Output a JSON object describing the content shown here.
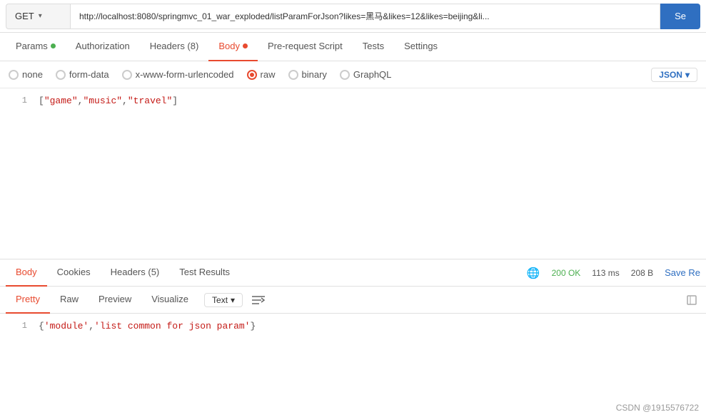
{
  "urlbar": {
    "method": "GET",
    "chevron": "▾",
    "url": "http://localhost:8080/springmvc_01_war_exploded/listParamForJson?likes=黑马&likes=12&likes=beijing&li...",
    "send_label": "Se"
  },
  "request_tabs": [
    {
      "id": "params",
      "label": "Params",
      "has_dot": true,
      "dot_type": "green",
      "active": false
    },
    {
      "id": "authorization",
      "label": "Authorization",
      "has_dot": false,
      "active": false
    },
    {
      "id": "headers",
      "label": "Headers (8)",
      "has_dot": false,
      "active": false
    },
    {
      "id": "body",
      "label": "Body",
      "has_dot": true,
      "dot_type": "orange",
      "active": true
    },
    {
      "id": "pre-request-script",
      "label": "Pre-request Script",
      "has_dot": false,
      "active": false
    },
    {
      "id": "tests",
      "label": "Tests",
      "has_dot": false,
      "active": false
    },
    {
      "id": "settings",
      "label": "Settings",
      "has_dot": false,
      "active": false
    }
  ],
  "body_options": [
    {
      "id": "none",
      "label": "none",
      "selected": false
    },
    {
      "id": "form-data",
      "label": "form-data",
      "selected": false
    },
    {
      "id": "x-www-form-urlencoded",
      "label": "x-www-form-urlencoded",
      "selected": false
    },
    {
      "id": "raw",
      "label": "raw",
      "selected": true
    },
    {
      "id": "binary",
      "label": "binary",
      "selected": false
    },
    {
      "id": "graphql",
      "label": "GraphQL",
      "selected": false
    }
  ],
  "json_badge": "JSON",
  "editor_code": "[\"game\",\"music\",\"travel\"]",
  "response": {
    "tabs": [
      {
        "id": "body",
        "label": "Body",
        "active": true
      },
      {
        "id": "cookies",
        "label": "Cookies",
        "active": false
      },
      {
        "id": "headers",
        "label": "Headers (5)",
        "active": false
      },
      {
        "id": "test-results",
        "label": "Test Results",
        "active": false
      }
    ],
    "status": "200 OK",
    "time": "113 ms",
    "size": "208 B",
    "save_label": "Save Re",
    "body_tabs": [
      {
        "id": "pretty",
        "label": "Pretty",
        "active": true
      },
      {
        "id": "raw",
        "label": "Raw",
        "active": false
      },
      {
        "id": "preview",
        "label": "Preview",
        "active": false
      },
      {
        "id": "visualize",
        "label": "Visualize",
        "active": false
      }
    ],
    "text_dropdown": "Text",
    "chevron": "▾",
    "response_code": "{'module','list common for json param'}",
    "response_line_num": "1",
    "watermark": "CSDN @1915576722"
  }
}
